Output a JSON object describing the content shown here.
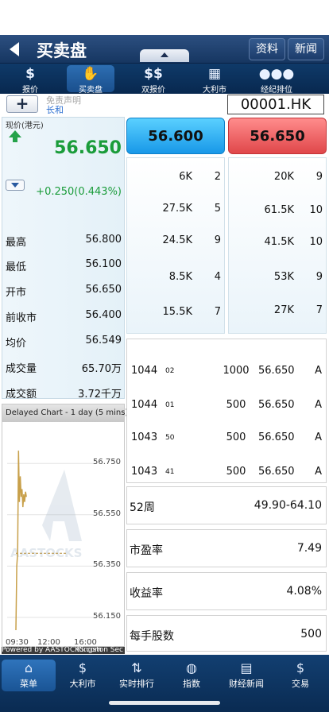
{
  "header": {
    "title": "买卖盘",
    "btn_info": "资料",
    "btn_news": "新闻"
  },
  "toolbar": [
    {
      "icon": "dollar-icon",
      "label": "报价"
    },
    {
      "icon": "hand-coin-icon",
      "label": "买卖盘"
    },
    {
      "icon": "double-dollar-icon",
      "label": "双报价"
    },
    {
      "icon": "grid-icon",
      "label": "大利市"
    },
    {
      "icon": "people-icon",
      "label": "经纪排位"
    }
  ],
  "subbar": {
    "disclaimer": "免责声明",
    "stock_name": "长和",
    "stock_code": "00001.HK"
  },
  "quote": {
    "label": "现价(港元)",
    "price": "56.650",
    "change": "+0.250(0.443%)",
    "direction_color": "#1a9c3a",
    "stats": [
      {
        "k": "最高",
        "v": "56.800"
      },
      {
        "k": "最低",
        "v": "56.100"
      },
      {
        "k": "开市",
        "v": "56.650"
      },
      {
        "k": "前收市",
        "v": "56.400"
      },
      {
        "k": "均价",
        "v": "56.549"
      },
      {
        "k": "成交量",
        "v": "65.70万"
      },
      {
        "k": "成交额",
        "v": "3.72千万"
      }
    ]
  },
  "chart": {
    "title": "Delayed Chart - 1 day (5 mins)",
    "watermark": "AASTOCKS",
    "powered_by": "Powered by AASTOCKS.com",
    "credit": "Kingston Sec"
  },
  "chart_data": {
    "type": "line",
    "title": "Delayed Chart - 1 day (5 mins)",
    "xlabel": "",
    "ylabel": "",
    "y_ticks": [
      "56.750",
      "56.550",
      "56.350",
      "56.150"
    ],
    "x_ticks": [
      "09:30",
      "12:00",
      "16:00"
    ],
    "ylim": [
      56.1,
      56.85
    ],
    "x": [
      "09:30",
      "09:35",
      "09:40",
      "09:45",
      "09:50",
      "09:55",
      "10:00",
      "10:05",
      "10:10",
      "10:15",
      "10:20",
      "10:25",
      "10:30"
    ],
    "series": [
      {
        "values": [
          56.1,
          56.35,
          56.4,
          56.8,
          56.6,
          56.7,
          56.62,
          56.65,
          56.58,
          56.63,
          56.6,
          56.64,
          56.62
        ]
      }
    ],
    "reference_line": 56.4
  },
  "order_book": {
    "bid_price": "56.600",
    "ask_price": "56.650",
    "bids": [
      {
        "vol": "6K",
        "cnt": "2"
      },
      {
        "vol": "27.5K",
        "cnt": "5"
      },
      {
        "vol": "24.5K",
        "cnt": "9"
      },
      {
        "vol": "8.5K",
        "cnt": "4"
      },
      {
        "vol": "15.5K",
        "cnt": "7"
      }
    ],
    "asks": [
      {
        "vol": "20K",
        "cnt": "9"
      },
      {
        "vol": "61.5K",
        "cnt": "10"
      },
      {
        "vol": "41.5K",
        "cnt": "10"
      },
      {
        "vol": "53K",
        "cnt": "9"
      },
      {
        "vol": "27K",
        "cnt": "7"
      }
    ]
  },
  "trades": [
    {
      "broker": "1044",
      "seq": "02",
      "qty": "1000",
      "price": "56.650",
      "side": "A"
    },
    {
      "broker": "1044",
      "seq": "01",
      "qty": "500",
      "price": "56.650",
      "side": "A"
    },
    {
      "broker": "1043",
      "seq": "50",
      "qty": "500",
      "price": "56.650",
      "side": "A"
    },
    {
      "broker": "1043",
      "seq": "41",
      "qty": "500",
      "price": "56.650",
      "side": "A"
    }
  ],
  "info": [
    {
      "k": "52周",
      "v": "49.90-64.10"
    },
    {
      "k": "市盈率",
      "v": "7.49"
    },
    {
      "k": "收益率",
      "v": "4.08%"
    },
    {
      "k": "每手股数",
      "v": "500"
    }
  ],
  "bottom_nav": [
    {
      "icon": "home-icon",
      "label": "菜单"
    },
    {
      "icon": "dollar-icon",
      "label": "大利市"
    },
    {
      "icon": "updown-icon",
      "label": "实时排行"
    },
    {
      "icon": "globe-icon",
      "label": "指数"
    },
    {
      "icon": "document-icon",
      "label": "财经新闻"
    },
    {
      "icon": "dollar-icon",
      "label": "交易"
    }
  ]
}
